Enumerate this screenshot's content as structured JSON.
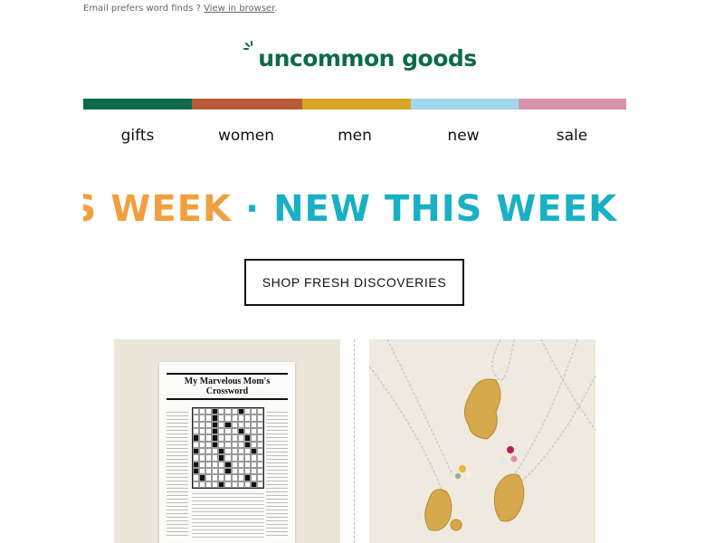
{
  "preheader": {
    "text": "Email prefers word finds ? ",
    "link": "View in browser",
    "suffix": "."
  },
  "logo": {
    "text": "uncommon goods",
    "icon": "spark-icon"
  },
  "colors": {
    "brand_green": "#0d6b4a",
    "bar": [
      "#0d6b4a",
      "#b95a3a",
      "#d8a625",
      "#a2d6ea",
      "#d994ac"
    ],
    "ticker_orange": "#f0a040",
    "ticker_teal": "#1ab0c4"
  },
  "nav": [
    {
      "label": "gifts"
    },
    {
      "label": "women"
    },
    {
      "label": "men"
    },
    {
      "label": "new"
    },
    {
      "label": "sale"
    }
  ],
  "ticker": {
    "text_orange": "NEW THIS WEEK",
    "text_teal": "NEW THIS WEEK",
    "separator": "·"
  },
  "cta": {
    "label": "SHOP FRESH DISCOVERIES"
  },
  "products": [
    {
      "title": "My Marvelous Mom's Crossword"
    },
    {
      "image": "zodiac-necklaces"
    }
  ]
}
